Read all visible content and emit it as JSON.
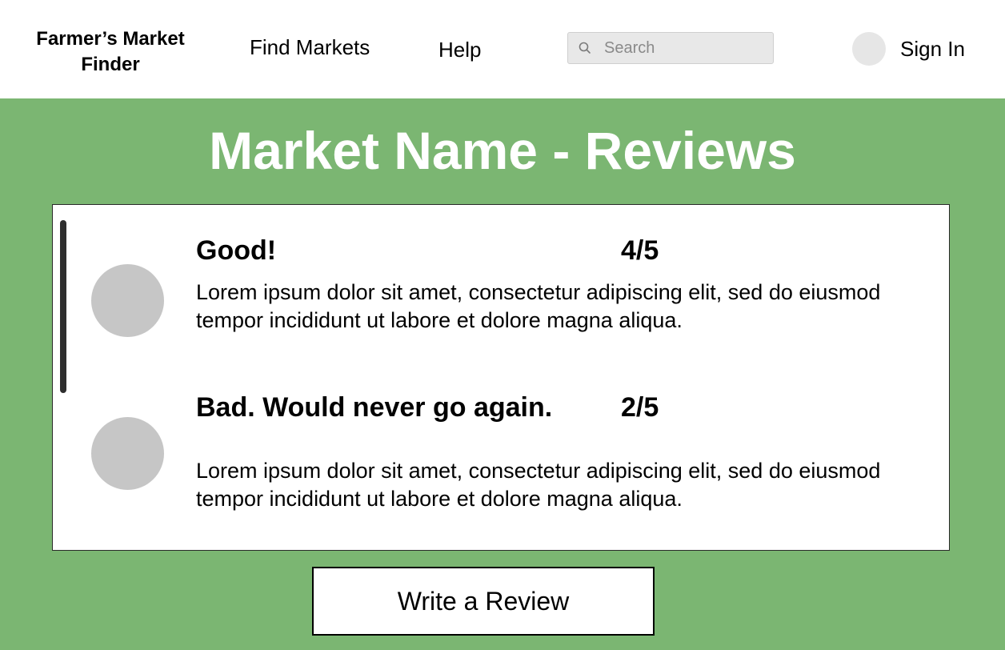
{
  "header": {
    "brand": "Farmer’s Market Finder",
    "nav": {
      "find_markets": "Find Markets",
      "help": "Help"
    },
    "search": {
      "placeholder": "Search",
      "value": ""
    },
    "sign_in": "Sign In",
    "icons": {
      "search": "search-icon",
      "avatar": "user-avatar"
    }
  },
  "main": {
    "title": "Market Name - Reviews",
    "reviews": [
      {
        "title": "Good!",
        "rating": "4/5",
        "body": "Lorem ipsum dolor sit amet, consectetur adipiscing elit, sed do eiusmod tempor incididunt ut labore et dolore magna aliqua."
      },
      {
        "title": "Bad. Would never go again.",
        "rating": "2/5",
        "body": "Lorem ipsum dolor sit amet, consectetur adipiscing elit, sed do eiusmod tempor incididunt ut labore et dolore magna aliqua."
      }
    ],
    "write_review_label": "Write a Review"
  },
  "colors": {
    "background": "#7bb672",
    "header": "#ffffff",
    "avatar": "#c6c6c6",
    "search_bg": "#e8e8e8"
  }
}
